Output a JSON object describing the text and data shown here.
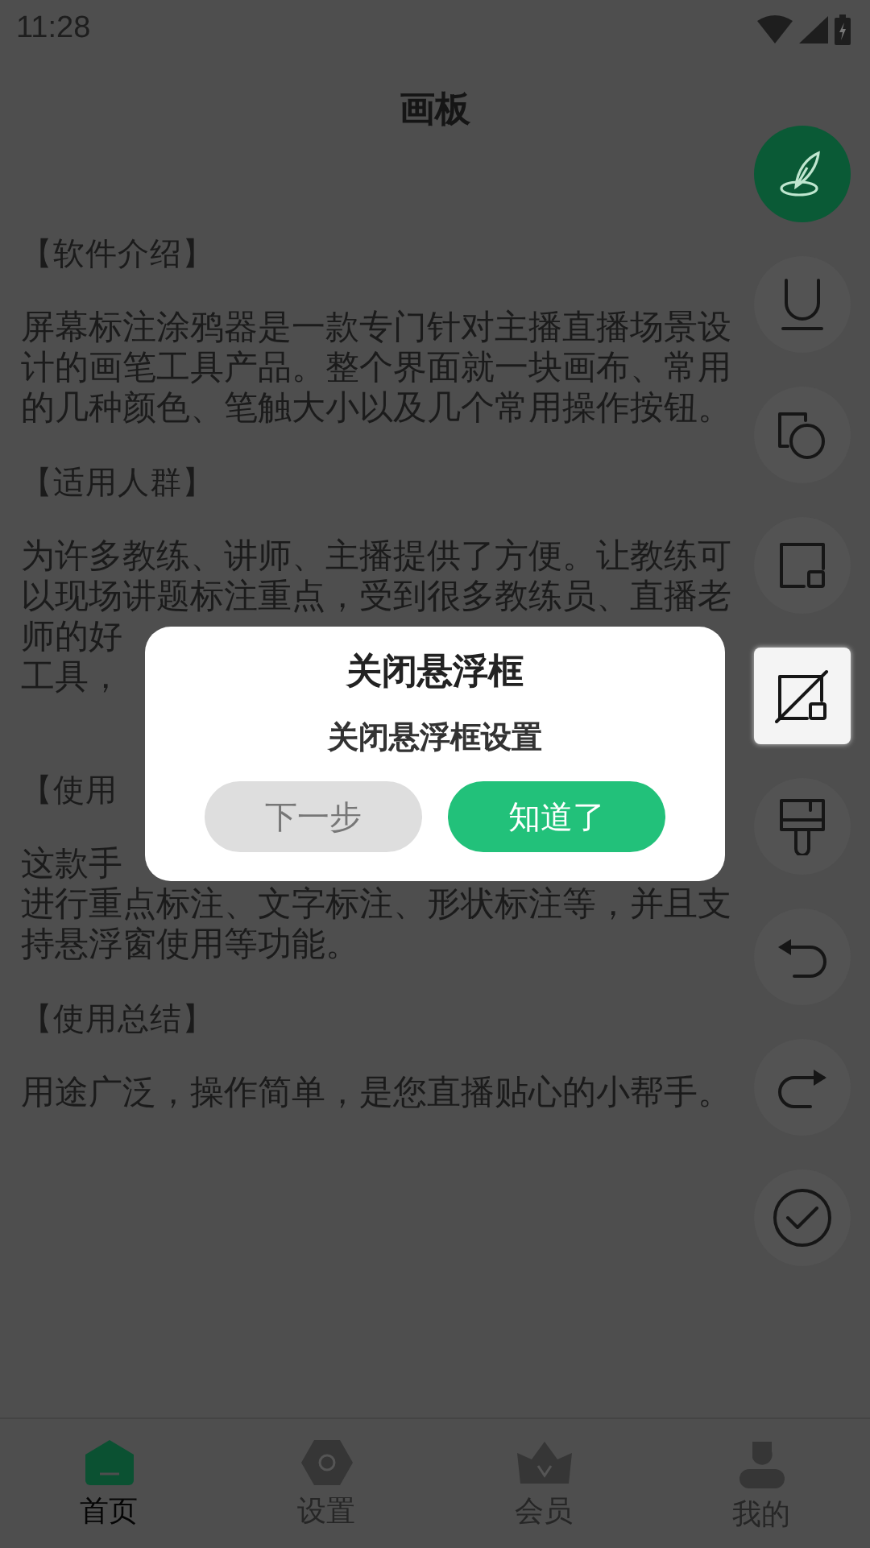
{
  "status_bar": {
    "time": "11:28"
  },
  "title": "画板",
  "content": [
    {
      "kind": "heading",
      "lines": [
        "【软件介绍】"
      ]
    },
    {
      "kind": "paragraph",
      "lines": [
        "屏幕标注涂鸦器是一款专门针对主播直播场景设",
        "计的画笔工具产品。整个界面就一块画布、常用",
        "的几种颜色、笔触大小以及几个常用操作按钮。"
      ]
    },
    {
      "kind": "heading",
      "lines": [
        "【适用人群】"
      ]
    },
    {
      "kind": "paragraph",
      "lines": [
        "为许多教练、讲师、主播提供了方便。让教练可",
        "以现场讲题标注重点，受到很多教练员、直播老",
        "师的好",
        "工具，"
      ]
    },
    {
      "kind": "heading",
      "lines": [
        "【使用"
      ]
    },
    {
      "kind": "paragraph",
      "lines": [
        "这款手",
        "进行重点标注、文字标注、形状标注等，并且支",
        "持悬浮窗使用等功能。"
      ]
    },
    {
      "kind": "heading",
      "lines": [
        "【使用总结】"
      ]
    },
    {
      "kind": "paragraph",
      "lines": [
        "用途广泛，操作简单，是您直播贴心的小帮手。"
      ]
    }
  ],
  "tools": [
    {
      "kind": "quill",
      "on": true,
      "selected": false
    },
    {
      "kind": "underline",
      "on": false,
      "selected": false
    },
    {
      "kind": "shapes",
      "on": false,
      "selected": false
    },
    {
      "kind": "square",
      "on": false,
      "selected": false
    },
    {
      "kind": "erase",
      "on": false,
      "selected": true
    },
    {
      "kind": "brush",
      "on": false,
      "selected": false
    },
    {
      "kind": "undo",
      "on": false,
      "selected": false
    },
    {
      "kind": "redo",
      "on": false,
      "selected": false
    },
    {
      "kind": "done",
      "on": false,
      "selected": false
    }
  ],
  "dialog": {
    "title": "关闭悬浮框",
    "message": "关闭悬浮框设置",
    "buttons": [
      {
        "kind": "secondary",
        "label": "下一步"
      },
      {
        "kind": "primary",
        "label": "知道了"
      }
    ]
  },
  "nav": [
    {
      "kind": "home",
      "label": "首页",
      "selected": true
    },
    {
      "kind": "settings",
      "label": "设置",
      "selected": false
    },
    {
      "kind": "vip",
      "label": "会员",
      "selected": false
    },
    {
      "kind": "me",
      "label": "我的",
      "selected": false
    }
  ]
}
